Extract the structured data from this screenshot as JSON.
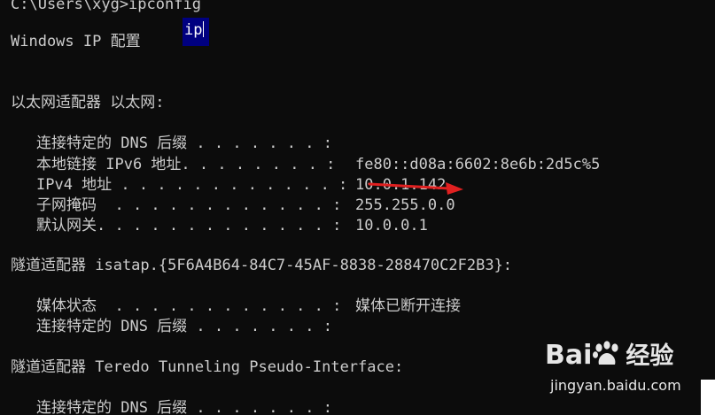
{
  "console": {
    "prompt": "C:\\Users\\xyg>ipconfig",
    "heading": "Windows IP 配置",
    "selection_text": "ip",
    "ethernet_header": "以太网适配器 以太网:",
    "ethernet": [
      {
        "label": "连接特定的 DNS 后缀 . . . . . . . :",
        "value": ""
      },
      {
        "label": "本地链接 IPv6 地址. . . . . . . . :",
        "value": "fe80::d08a:6602:8e6b:2d5c%5"
      },
      {
        "label": "IPv4 地址 . . . . . . . . . . . . :",
        "value": "10.0.1.142"
      },
      {
        "label": "子网掩码  . . . . . . . . . . . . :",
        "value": "255.255.0.0"
      },
      {
        "label": "默认网关. . . . . . . . . . . . . :",
        "value": "10.0.0.1"
      }
    ],
    "isatap_header": "隧道适配器 isatap.{5F6A4B64-84C7-45AF-8838-288470C2F2B3}:",
    "isatap": [
      {
        "label": "媒体状态  . . . . . . . . . . . . :",
        "value": "媒体已断开连接"
      },
      {
        "label": "连接特定的 DNS 后缀 . . . . . . . :",
        "value": ""
      }
    ],
    "teredo_header": "隧道适配器 Teredo Tunneling Pseudo-Interface:",
    "teredo": [
      {
        "label": "连接特定的 DNS 后缀 . . . . . . . :",
        "value": ""
      }
    ]
  },
  "colors": {
    "background": "#0c0c0c",
    "text": "#cccccc",
    "selection_bg": "#000080",
    "arrow": "#e02020"
  },
  "watermark": {
    "logo_text": "Bai",
    "logo_suffix": "经验",
    "url": "jingyan.baidu.com"
  }
}
